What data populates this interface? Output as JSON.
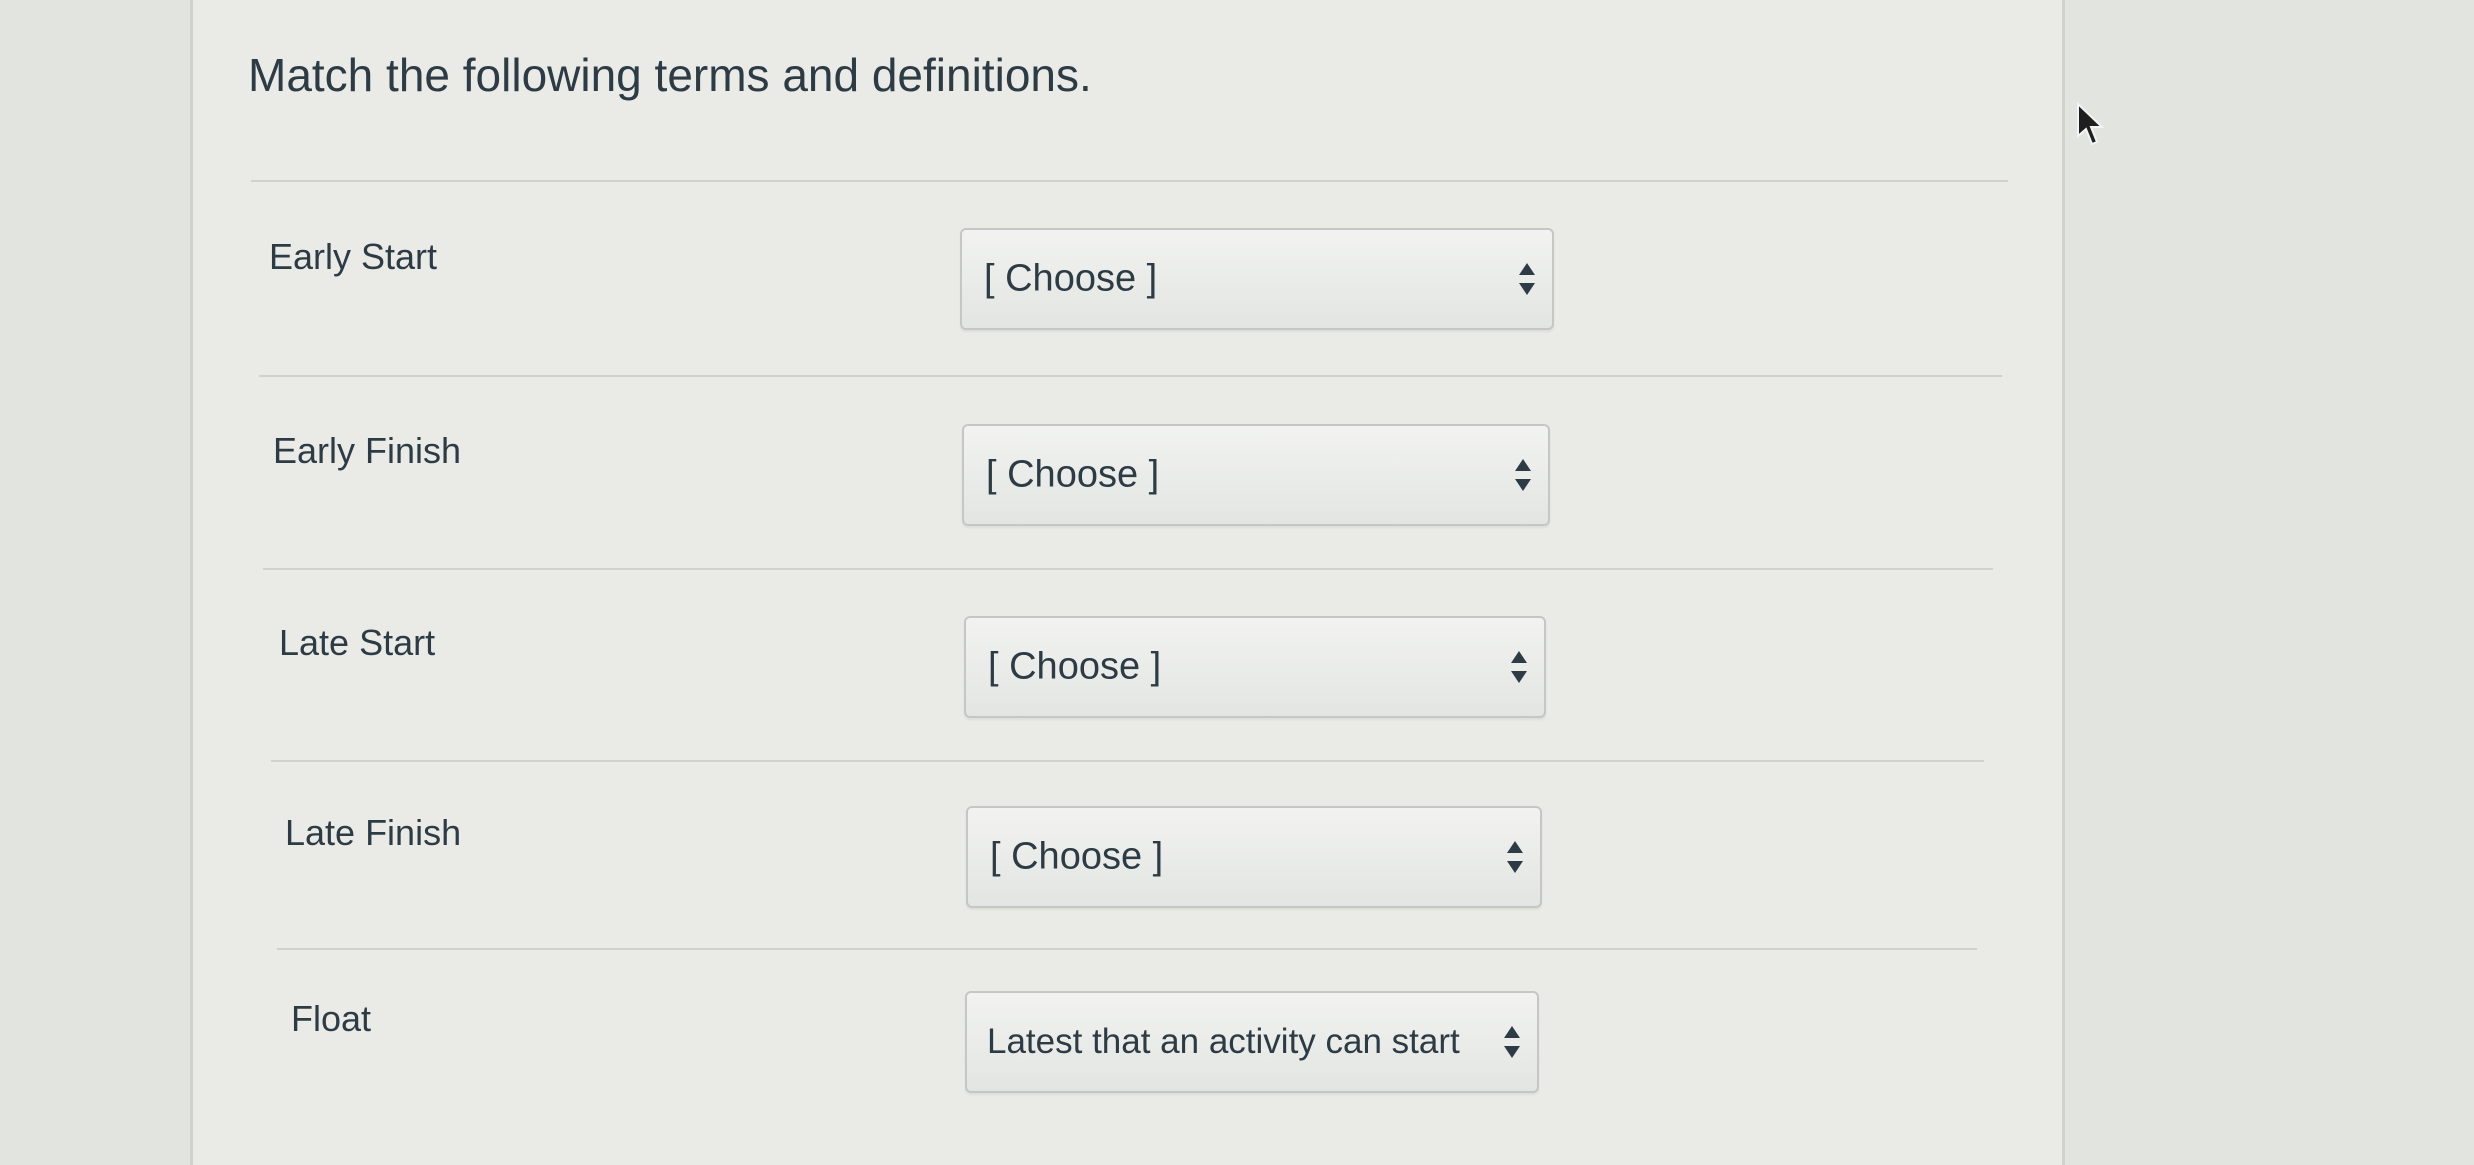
{
  "question": {
    "prompt": "Match the following terms and definitions."
  },
  "matches": [
    {
      "term": "Early Start",
      "selected": "[ Choose ]"
    },
    {
      "term": "Early Finish",
      "selected": "[ Choose ]"
    },
    {
      "term": "Late Start",
      "selected": "[ Choose ]"
    },
    {
      "term": "Late Finish",
      "selected": "[ Choose ]"
    },
    {
      "term": "Float",
      "selected": "Latest that an activity can start"
    }
  ],
  "icons": {
    "select_arrows": "up-down-arrows-icon",
    "cursor": "mouse-pointer-icon"
  },
  "colors": {
    "text": "#2d3b45",
    "background": "#eaebe7"
  }
}
